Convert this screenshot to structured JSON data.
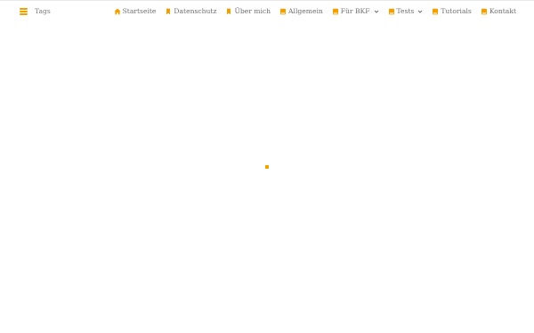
{
  "colors": {
    "accent": "#f0a000",
    "text": "#6e6e6e",
    "muted": "#7a7a7a",
    "background": "#ffffff"
  },
  "header": {
    "menu_icon": "hamburger-icon",
    "tags_label": "Tags"
  },
  "nav": {
    "items": [
      {
        "label": "Startseite",
        "icon": "home-icon",
        "has_dropdown": false
      },
      {
        "label": "Datenschutz",
        "icon": "bookmark-icon",
        "has_dropdown": false
      },
      {
        "label": "Über mich",
        "icon": "bookmark-icon",
        "has_dropdown": false
      },
      {
        "label": "Allgemein",
        "icon": "book-icon",
        "has_dropdown": false
      },
      {
        "label": "Für BKF",
        "icon": "book-icon",
        "has_dropdown": true
      },
      {
        "label": "Tests",
        "icon": "book-icon",
        "has_dropdown": true
      },
      {
        "label": "Tutorials",
        "icon": "book-icon",
        "has_dropdown": false
      },
      {
        "label": "Kontakt",
        "icon": "book-icon",
        "has_dropdown": false
      }
    ]
  },
  "content": {
    "loading_indicator": "loading-dot"
  }
}
